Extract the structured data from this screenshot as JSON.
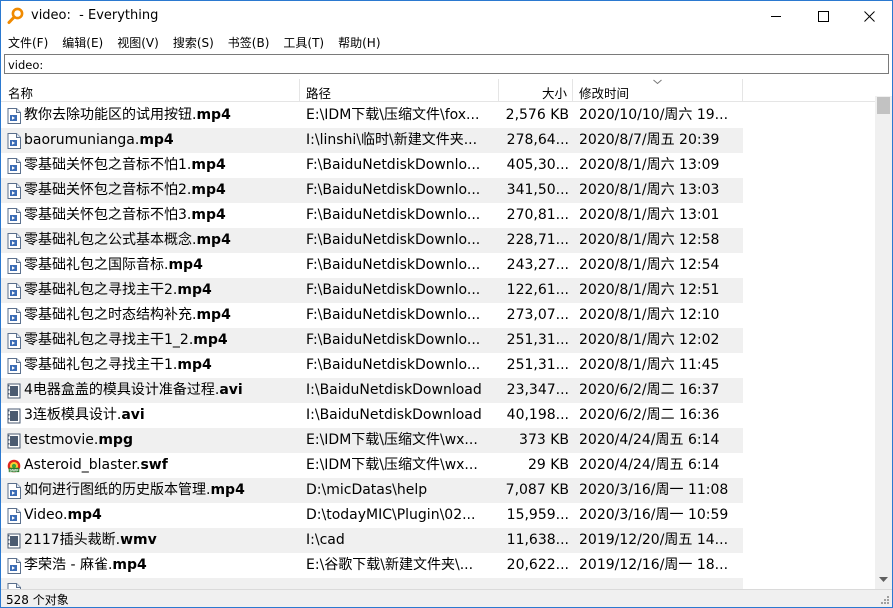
{
  "window": {
    "title": "video:  - Everything",
    "accent_color": "#2b79d0"
  },
  "menu": [
    "文件(F)",
    "编辑(E)",
    "视图(V)",
    "搜索(S)",
    "书签(B)",
    "工具(T)",
    "帮助(H)"
  ],
  "search": {
    "value": "video:"
  },
  "columns": {
    "name": "名称",
    "path": "路径",
    "size": "大小",
    "modified": "修改时间"
  },
  "rows": [
    {
      "icon": "video-file-icon",
      "base": "教你去除功能区的试用按钮.",
      "ext": "mp4",
      "path": "E:\\IDM下载\\压缩文件\\fox...",
      "size": "2,576 KB",
      "modified": "2020/10/10/周六 19..."
    },
    {
      "icon": "video-file-icon",
      "base": "baorumunianga.",
      "ext": "mp4",
      "path": "I:\\linshi\\临时\\新建文件夹...",
      "size": "278,64...",
      "modified": "2020/8/7/周五 20:39"
    },
    {
      "icon": "video-file-icon",
      "base": "零基础关怀包之音标不怕1.",
      "ext": "mp4",
      "path": "F:\\BaiduNetdiskDownlo...",
      "size": "405,30...",
      "modified": "2020/8/1/周六 13:09"
    },
    {
      "icon": "video-file-icon",
      "base": "零基础关怀包之音标不怕2.",
      "ext": "mp4",
      "path": "F:\\BaiduNetdiskDownlo...",
      "size": "341,50...",
      "modified": "2020/8/1/周六 13:03"
    },
    {
      "icon": "video-file-icon",
      "base": "零基础关怀包之音标不怕3.",
      "ext": "mp4",
      "path": "F:\\BaiduNetdiskDownlo...",
      "size": "270,81...",
      "modified": "2020/8/1/周六 13:01"
    },
    {
      "icon": "video-file-icon",
      "base": "零基础礼包之公式基本概念.",
      "ext": "mp4",
      "path": "F:\\BaiduNetdiskDownlo...",
      "size": "228,71...",
      "modified": "2020/8/1/周六 12:58"
    },
    {
      "icon": "video-file-icon",
      "base": "零基础礼包之国际音标.",
      "ext": "mp4",
      "path": "F:\\BaiduNetdiskDownlo...",
      "size": "243,27...",
      "modified": "2020/8/1/周六 12:54"
    },
    {
      "icon": "video-file-icon",
      "base": "零基础礼包之寻找主干2.",
      "ext": "mp4",
      "path": "F:\\BaiduNetdiskDownlo...",
      "size": "122,61...",
      "modified": "2020/8/1/周六 12:51"
    },
    {
      "icon": "video-file-icon",
      "base": "零基础礼包之时态结构补充.",
      "ext": "mp4",
      "path": "F:\\BaiduNetdiskDownlo...",
      "size": "273,07...",
      "modified": "2020/8/1/周六 12:10"
    },
    {
      "icon": "video-file-icon",
      "base": "零基础礼包之寻找主干1_2.",
      "ext": "mp4",
      "path": "F:\\BaiduNetdiskDownlo...",
      "size": "251,31...",
      "modified": "2020/8/1/周六 12:02"
    },
    {
      "icon": "video-file-icon",
      "base": "零基础礼包之寻找主干1.",
      "ext": "mp4",
      "path": "F:\\BaiduNetdiskDownlo...",
      "size": "251,31...",
      "modified": "2020/8/1/周六 11:45"
    },
    {
      "icon": "film-file-icon",
      "base": "4电器盒盖的模具设计准备过程.",
      "ext": "avi",
      "path": "I:\\BaiduNetdiskDownload",
      "size": "23,347...",
      "modified": "2020/6/2/周二 16:37"
    },
    {
      "icon": "film-file-icon",
      "base": "3连板模具设计.",
      "ext": "avi",
      "path": "I:\\BaiduNetdiskDownload",
      "size": "40,198...",
      "modified": "2020/6/2/周二 16:36"
    },
    {
      "icon": "film-file-icon",
      "base": "testmovie.",
      "ext": "mpg",
      "path": "E:\\IDM下载\\压缩文件\\wx...",
      "size": "373 KB",
      "modified": "2020/4/24/周五 6:14"
    },
    {
      "icon": "swf-file-icon",
      "base": "Asteroid_blaster.",
      "ext": "swf",
      "path": "E:\\IDM下载\\压缩文件\\wx...",
      "size": "29 KB",
      "modified": "2020/4/24/周五 6:14"
    },
    {
      "icon": "video-file-icon",
      "base": "如何进行图纸的历史版本管理.",
      "ext": "mp4",
      "path": "D:\\micDatas\\help",
      "size": "7,087 KB",
      "modified": "2020/3/16/周一 11:08"
    },
    {
      "icon": "video-file-icon",
      "base": "Video.",
      "ext": "mp4",
      "path": "D:\\todayMIC\\Plugin\\02...",
      "size": "15,959...",
      "modified": "2020/3/16/周一 10:59"
    },
    {
      "icon": "film-file-icon",
      "base": "2117插头裁断.",
      "ext": "wmv",
      "path": "I:\\cad",
      "size": "11,638...",
      "modified": "2019/12/20/周五 14..."
    },
    {
      "icon": "video-file-icon",
      "base": "李荣浩 - 麻雀.",
      "ext": "mp4",
      "path": "E:\\谷歌下载\\新建文件夹\\...",
      "size": "20,622...",
      "modified": "2019/12/16/周一 18..."
    },
    {
      "icon": "video-file-icon",
      "base": "",
      "ext": "",
      "path": "",
      "size": "",
      "modified": ""
    }
  ],
  "status": {
    "text": "528 个对象"
  }
}
